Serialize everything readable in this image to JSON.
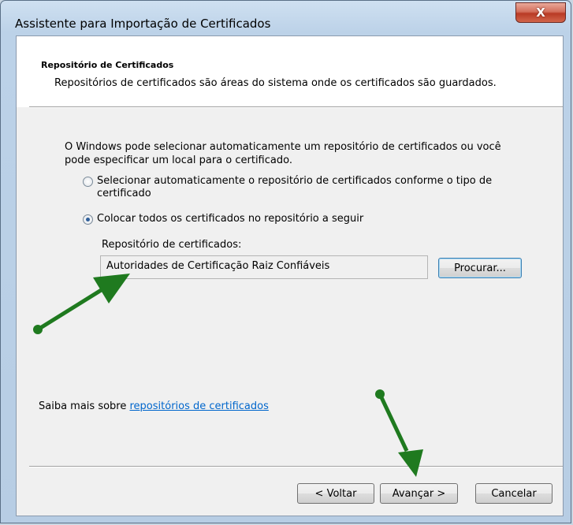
{
  "window": {
    "title": "Assistente para Importação de Certificados",
    "close_label": "X"
  },
  "header": {
    "section_title": "Repositório de Certificados",
    "section_description": "Repositórios de certificados são áreas do sistema onde os certificados são guardados."
  },
  "body": {
    "intro": "O Windows pode selecionar automaticamente um repositório de certificados ou você pode especificar um local para o certificado.",
    "options": [
      {
        "label": "Selecionar automaticamente o repositório de certificados conforme o tipo de certificado",
        "selected": false
      },
      {
        "label": "Colocar todos os certificados no repositório a seguir",
        "selected": true
      }
    ],
    "store_label": "Repositório de certificados:",
    "store_value": "Autoridades de Certificação Raiz Confiáveis",
    "browse_label": "Procurar..."
  },
  "learn_more": {
    "prefix": "Saiba mais sobre ",
    "link": "repositórios de certificados"
  },
  "footer": {
    "back_label": "< Voltar",
    "next_label": "Avançar >",
    "cancel_label": "Cancelar"
  },
  "colors": {
    "annotation_arrow": "#1f7a1f",
    "link": "#0066cc",
    "close_button": "#c8432c"
  }
}
